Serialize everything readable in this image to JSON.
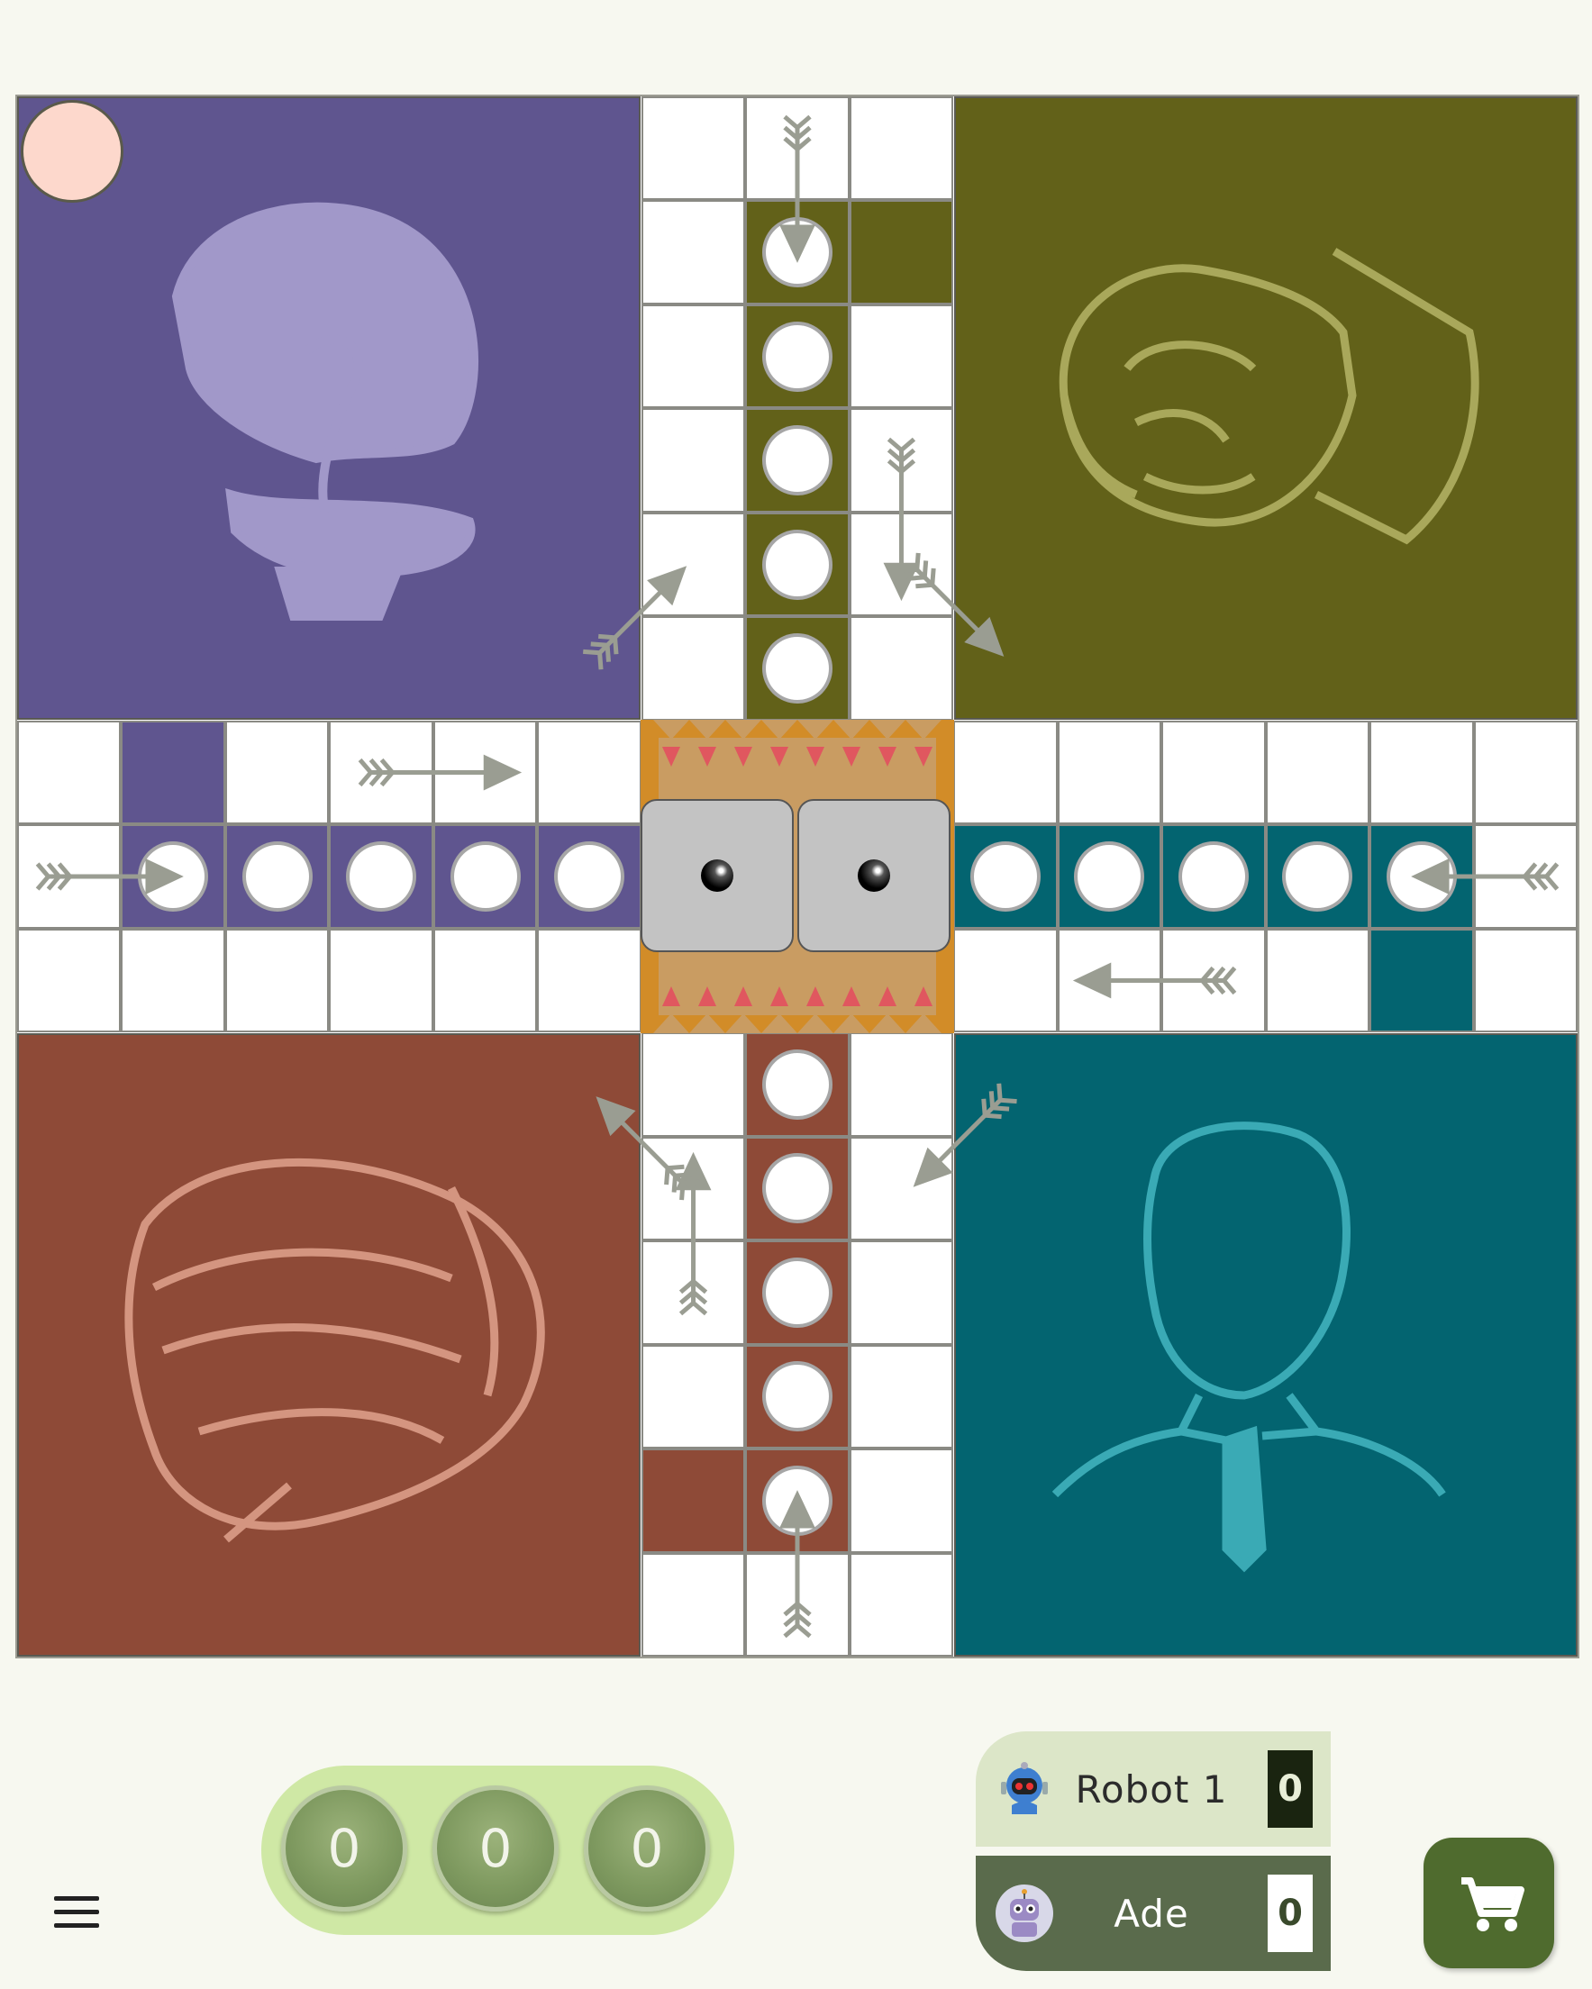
{
  "board": {
    "colors": {
      "purple": "#5f558f",
      "olive": "#626119",
      "teal": "#036470",
      "brown": "#8e4a37",
      "purple_art": "#a198c9",
      "olive_art": "#a9a85b",
      "teal_art": "#3aaab5",
      "brown_art": "#d49580",
      "arrow": "#9a9d92",
      "center_orange": "#d28c28",
      "center_pink": "#e0575f",
      "center_tan": "#c99c62"
    },
    "yards": [
      "purple-yard",
      "olive-yard",
      "brown-yard",
      "teal-yard"
    ],
    "dice": [
      1,
      1
    ],
    "player_token_color": "#fdd8cc"
  },
  "counters": [
    "0",
    "0",
    "0"
  ],
  "players": [
    {
      "name": "Robot 1",
      "score": "0",
      "avatar": "robot-icon"
    },
    {
      "name": "Ade",
      "score": "0",
      "avatar": "robot-avatar-icon"
    }
  ],
  "controls": {
    "menu_icon": "hamburger-menu-icon",
    "cart_icon": "shopping-cart-icon"
  }
}
